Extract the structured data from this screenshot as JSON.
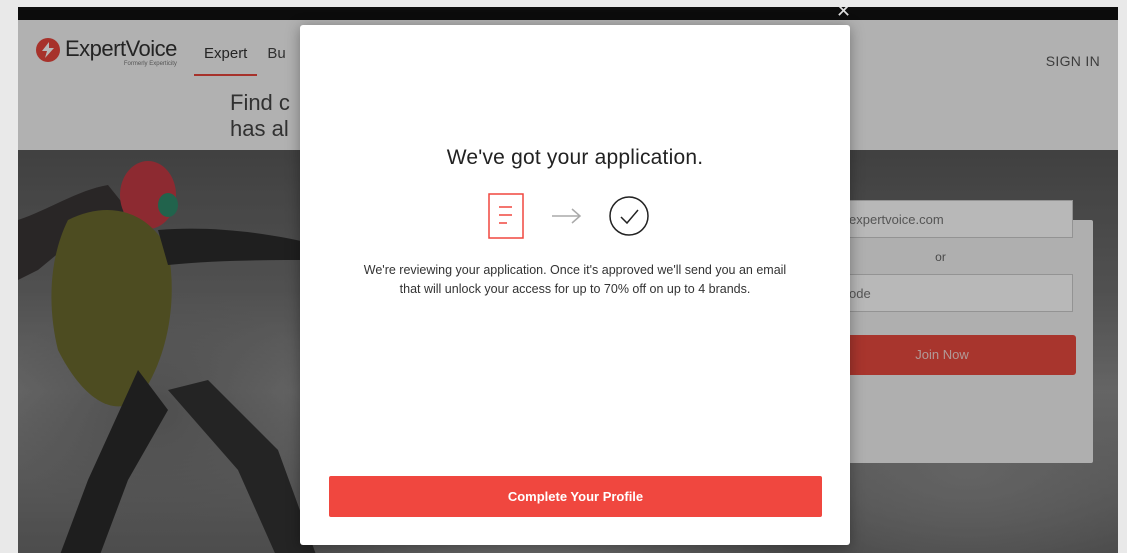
{
  "header": {
    "logo_name": "ExpertVoice",
    "logo_subtitle": "Formerly Experticity",
    "nav": [
      {
        "label": "Expert",
        "active": true
      },
      {
        "label": "Bu"
      }
    ],
    "sign_in": "SIGN IN",
    "headline_line1": "Find c",
    "headline_line2": "has al"
  },
  "signup_card": {
    "email_placeholder": "expertvoice.com",
    "or_text": "or",
    "code_placeholder": "ode",
    "join_button": "Join Now"
  },
  "modal": {
    "title": "We've got your application.",
    "message_line1": "We're reviewing your application. Once it's approved we'll send you an email",
    "message_line2": "that will unlock your access for up to 70% off on up to 4 brands.",
    "cta": "Complete Your Profile",
    "icons": [
      "document-icon",
      "arrow-right-icon",
      "check-circle-icon"
    ]
  },
  "colors": {
    "brand_red": "#f0473f",
    "dark_text": "#222222"
  }
}
